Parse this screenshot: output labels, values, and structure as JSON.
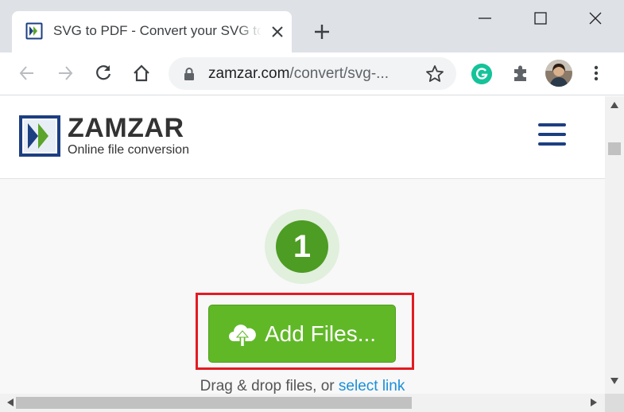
{
  "browser": {
    "tab_title": "SVG to PDF - Convert your SVG to PDF for Free Online",
    "url_host": "zamzar.com",
    "url_path": "/convert/svg-...",
    "icons": {
      "favicon": "zamzar-favicon-icon",
      "back": "back-arrow-icon",
      "forward": "forward-arrow-icon",
      "reload": "reload-icon",
      "home": "home-icon",
      "lock": "lock-icon",
      "star": "star-icon",
      "grammarly": "grammarly-icon",
      "extensions": "puzzle-icon",
      "menu": "more-vert-icon"
    }
  },
  "site": {
    "brand": "ZAMZAR",
    "trademark": "™",
    "tagline": "Online file conversion"
  },
  "step": {
    "number": "1",
    "button_label": "Add Files...",
    "drag_text": "Drag & drop files, or",
    "select_link": "select link"
  },
  "colors": {
    "brand_blue": "#1c3f82",
    "button_green": "#60b827",
    "step_green": "#4d9c23",
    "highlight_red": "#e31b23",
    "link_blue": "#1a8fd9"
  }
}
